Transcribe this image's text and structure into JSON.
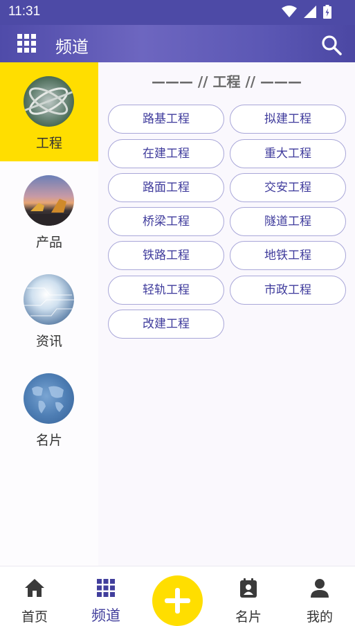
{
  "status_bar": {
    "time": "11:31"
  },
  "app_bar": {
    "title": "频道"
  },
  "sidebar": {
    "items": [
      {
        "label": "工程",
        "active": true,
        "thumb_icon": "highway-interchange-photo"
      },
      {
        "label": "产品",
        "active": false,
        "thumb_icon": "construction-machinery-photo"
      },
      {
        "label": "资讯",
        "active": false,
        "thumb_icon": "circuit-network-photo"
      },
      {
        "label": "名片",
        "active": false,
        "thumb_icon": "world-map-globe-photo"
      }
    ]
  },
  "content": {
    "section_title": "——— // 工程 // ———",
    "chips": [
      "路基工程",
      "拟建工程",
      "在建工程",
      "重大工程",
      "路面工程",
      "交安工程",
      "桥梁工程",
      "隧道工程",
      "铁路工程",
      "地铁工程",
      "轻轨工程",
      "市政工程",
      "改建工程"
    ]
  },
  "bottom_nav": {
    "items": [
      {
        "label": "首页",
        "icon": "home-icon"
      },
      {
        "label": "频道",
        "icon": "grid-icon",
        "active": true
      },
      {
        "label": "名片",
        "icon": "contact-card-icon"
      },
      {
        "label": "我的",
        "icon": "person-icon"
      }
    ],
    "fab_icon": "plus-icon"
  },
  "colors": {
    "primary": "#4d4aa6",
    "accent_yellow": "#ffde00",
    "chip_text": "#3f3b9c",
    "chip_border": "#a8a6d8"
  }
}
